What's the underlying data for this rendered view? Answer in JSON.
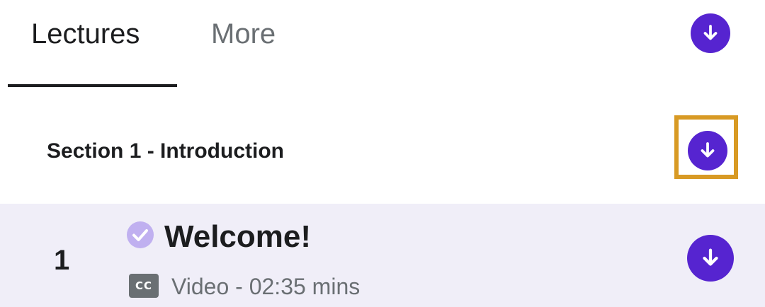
{
  "tabs": [
    {
      "label": "Lectures",
      "active": true
    },
    {
      "label": "More",
      "active": false
    }
  ],
  "section": {
    "title": "Section 1 - Introduction"
  },
  "lectures": [
    {
      "number": "1",
      "title": "Welcome!",
      "completed": true,
      "caption_icon_text": "CC",
      "meta": "Video - 02:35 mins"
    }
  ],
  "icons": {
    "download": "download-arrow-icon",
    "completed": "check-circle-icon",
    "captions": "closed-captions-icon"
  },
  "colors": {
    "accent": "#5624d0",
    "highlight": "#d89a24",
    "row_background": "#f0eef8",
    "check": "#c0b0f0"
  }
}
